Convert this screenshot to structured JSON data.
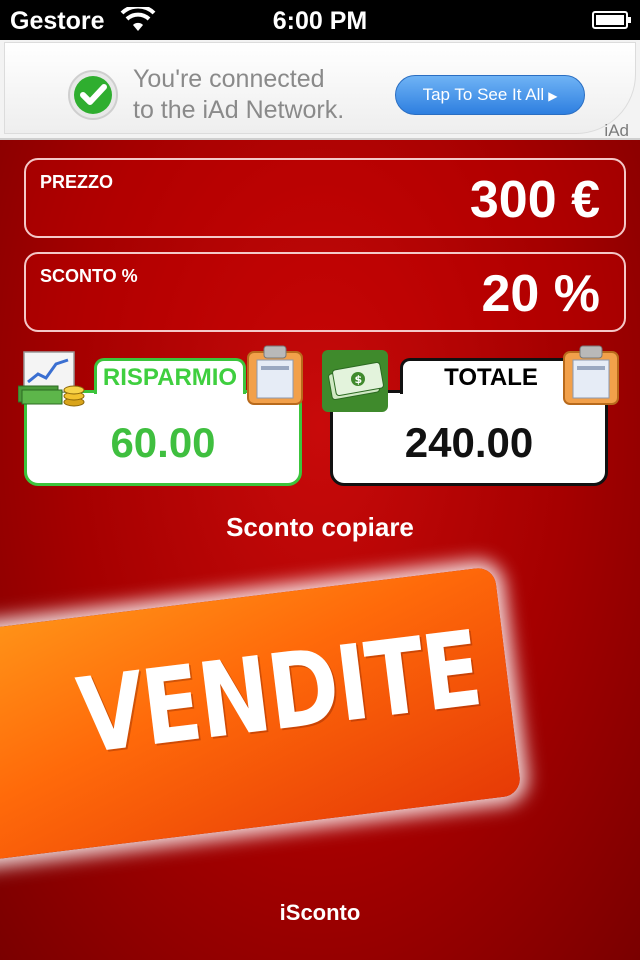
{
  "status_bar": {
    "carrier": "Gestore",
    "time": "6:00 PM",
    "wifi_icon": "wifi-icon",
    "battery_icon": "battery-icon"
  },
  "ad": {
    "line1": "You're connected",
    "line2": "to the iAd Network.",
    "cta": "Tap To See It All",
    "tag": "iAd",
    "check_icon": "checkmark-icon"
  },
  "fields": {
    "prezzo_label": "PREZZO",
    "prezzo_value": "300 €",
    "sconto_label": "SCONTO %",
    "sconto_value": "20 %"
  },
  "cards": {
    "risparmio_header": "RISPARMIO",
    "risparmio_value": "60.00",
    "totale_header": "TOTALE",
    "totale_value": "240.00"
  },
  "copy_label": "Sconto copiare",
  "sale_banner": "VENDITE",
  "footer": "iSconto",
  "colors": {
    "background_red": "#a50000",
    "risparmio_green": "#3fbf3f",
    "banner_orange": "#ff6a0a",
    "cta_blue": "#2e7fe0"
  }
}
